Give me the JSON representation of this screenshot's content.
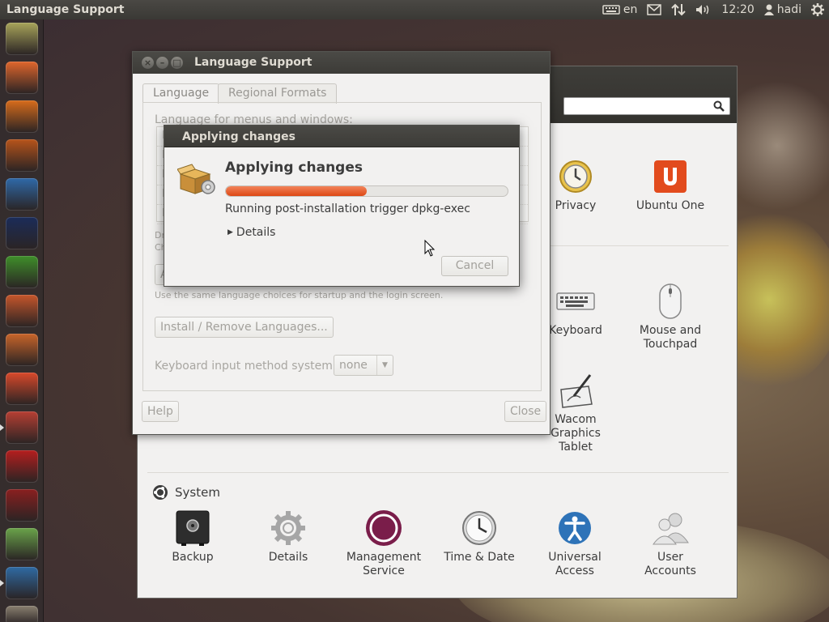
{
  "top_panel": {
    "title": "Language Support",
    "keyboard_layout": "en",
    "time": "12:20",
    "user": "hadi"
  },
  "launcher": {
    "items": [
      {
        "name": "dash-home",
        "color": "#a8a45a"
      },
      {
        "name": "files",
        "color": "#e0662c"
      },
      {
        "name": "vlc",
        "color": "#d86c1b"
      },
      {
        "name": "firefox",
        "color": "#b7541a"
      },
      {
        "name": "libreoffice-writer",
        "color": "#2f69a8"
      },
      {
        "name": "app-blue",
        "color": "#1b2c59"
      },
      {
        "name": "libreoffice-calc",
        "color": "#3f8f2a"
      },
      {
        "name": "libreoffice-impress",
        "color": "#c6562b"
      },
      {
        "name": "software-center",
        "color": "#c9652a"
      },
      {
        "name": "ubuntu-one",
        "color": "#d9492b"
      },
      {
        "name": "system-settings",
        "color": "#b73f33"
      },
      {
        "name": "filezilla",
        "color": "#b51e1e"
      },
      {
        "name": "wine",
        "color": "#8a1f1f"
      },
      {
        "name": "maps",
        "color": "#6aa34a"
      },
      {
        "name": "network",
        "color": "#2f6aa3"
      },
      {
        "name": "trash",
        "color": "#8a8070"
      }
    ]
  },
  "settings": {
    "personal_icons": [
      {
        "label": "Privacy"
      },
      {
        "label": "Ubuntu One"
      }
    ],
    "hardware_icons": [
      {
        "label": "Keyboard"
      },
      {
        "label": "Mouse and\nTouchpad"
      },
      {
        "label": "Wacom\nGraphics\nTablet"
      }
    ],
    "system_section_title": "System",
    "system_icons": [
      {
        "label": "Backup"
      },
      {
        "label": "Details"
      },
      {
        "label": "Management\nService"
      },
      {
        "label": "Time & Date"
      },
      {
        "label": "Universal\nAccess"
      },
      {
        "label": "User\nAccounts"
      }
    ]
  },
  "language_support": {
    "title": "Language Support",
    "tabs": [
      "Language",
      "Regional Formats"
    ],
    "languages_label": "Language for menus and windows:",
    "language_rows": [
      "E",
      "E",
      "E",
      "E",
      "E"
    ],
    "drag_hint_1": "Dr",
    "drag_hint_2": "Ch",
    "apply_button_partial": "A",
    "same_choices_hint": "Use the same language choices for startup and the login screen.",
    "install_button": "Install / Remove Languages...",
    "keyboard_input_label": "Keyboard input method system:",
    "keyboard_input_value": "none",
    "help_button": "Help",
    "close_button": "Close"
  },
  "applying_dialog": {
    "window_title": "Applying changes",
    "heading": "Applying changes",
    "progress": 0.5,
    "status": "Running post-installation trigger dpkg-exec",
    "details_label": "Details",
    "cancel_button": "Cancel"
  }
}
